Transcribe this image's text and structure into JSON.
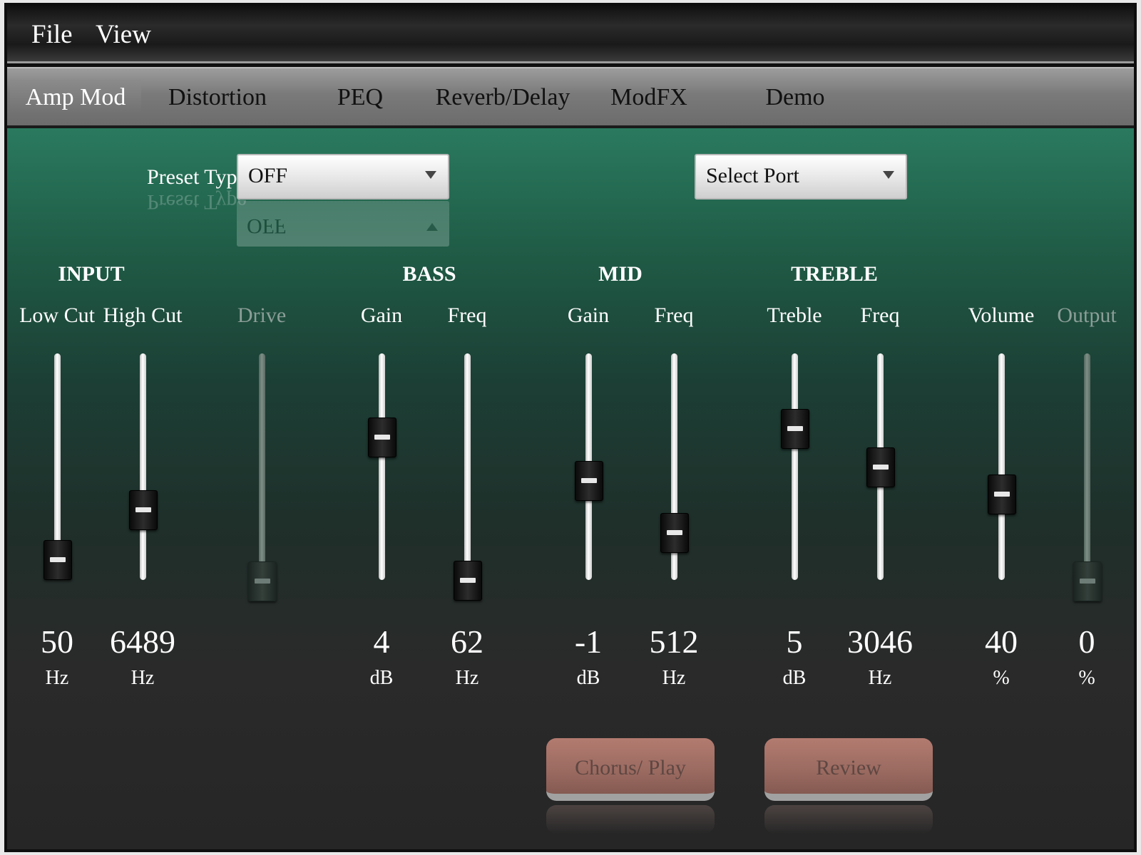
{
  "menu": {
    "file": "File",
    "view": "View"
  },
  "tabs": [
    "Amp Mod",
    "Distortion",
    "PEQ",
    "Reverb/Delay",
    "ModFX",
    "Demo"
  ],
  "active_tab": "Amp Mod",
  "preset": {
    "label": "Preset Type",
    "value": "OFF"
  },
  "port": {
    "value": "Select Port"
  },
  "groups": {
    "input": "INPUT",
    "bass": "BASS",
    "mid": "MID",
    "treble": "TREBLE"
  },
  "sliders": [
    {
      "id": "low-cut",
      "label": "Low Cut",
      "value": "50",
      "unit": "Hz",
      "level": 0.11,
      "enabled": true
    },
    {
      "id": "high-cut",
      "label": "High Cut",
      "value": "6489",
      "unit": "Hz",
      "level": 0.33,
      "enabled": true
    },
    {
      "id": "drive",
      "label": "Drive",
      "value": "",
      "unit": "",
      "level": 0.0,
      "enabled": false
    },
    {
      "id": "bass-gain",
      "label": "Gain",
      "value": "4",
      "unit": "dB",
      "level": 0.65,
      "enabled": true
    },
    {
      "id": "bass-freq",
      "label": "Freq",
      "value": "62",
      "unit": "Hz",
      "level": 0.02,
      "enabled": true
    },
    {
      "id": "mid-gain",
      "label": "Gain",
      "value": "-1",
      "unit": "dB",
      "level": 0.46,
      "enabled": true
    },
    {
      "id": "mid-freq",
      "label": "Freq",
      "value": "512",
      "unit": "Hz",
      "level": 0.23,
      "enabled": true
    },
    {
      "id": "treble",
      "label": "Treble",
      "value": "5",
      "unit": "dB",
      "level": 0.69,
      "enabled": true
    },
    {
      "id": "treble-freq",
      "label": "Freq",
      "value": "3046",
      "unit": "Hz",
      "level": 0.52,
      "enabled": true
    },
    {
      "id": "volume",
      "label": "Volume",
      "value": "40",
      "unit": "%",
      "level": 0.4,
      "enabled": true
    },
    {
      "id": "output",
      "label": "Output",
      "value": "0",
      "unit": "%",
      "level": 0.0,
      "enabled": false
    }
  ],
  "buttons": {
    "chorus": "Chorus/ Play",
    "review": "Review"
  }
}
